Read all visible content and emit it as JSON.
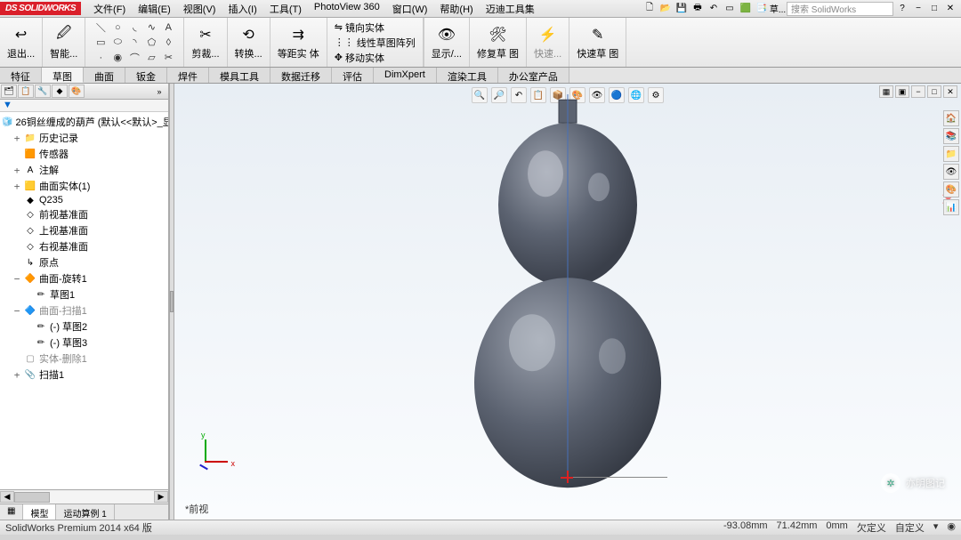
{
  "app": {
    "logo": "DS SOLIDWORKS"
  },
  "menu": [
    "文件(F)",
    "编辑(E)",
    "视图(V)",
    "插入(I)",
    "工具(T)",
    "PhotoView 360",
    "窗口(W)",
    "帮助(H)",
    "迈迪工具集"
  ],
  "search": {
    "placeholder": "搜索 SolidWorks"
  },
  "ribbon": {
    "exit": "退出...",
    "smart": "智能...",
    "trim": "剪裁...",
    "convert": "转换...",
    "offset": "等距实 体",
    "mirror": "镜向实体",
    "linear_pattern": "线性草图阵列",
    "move": "移动实体",
    "display": "显示/...",
    "repair": "修复草 图",
    "quick": "快速...",
    "quick_sketch": "快速草 图"
  },
  "tabs": [
    "特征",
    "草图",
    "曲面",
    "钣金",
    "焊件",
    "模具工具",
    "数据迁移",
    "评估",
    "DimXpert",
    "渲染工具",
    "办公室产品"
  ],
  "active_tab_index": 1,
  "tree": {
    "root": "26铜丝缠成的葫芦  (默认<<默认>_显示",
    "items": [
      {
        "icon": "📁",
        "label": "历史记录",
        "ind": 1,
        "tw": "+"
      },
      {
        "icon": "🟧",
        "label": "传感器",
        "ind": 1,
        "tw": ""
      },
      {
        "icon": "A",
        "label": "注解",
        "ind": 1,
        "tw": "+"
      },
      {
        "icon": "🟨",
        "label": "曲面实体(1)",
        "ind": 1,
        "tw": "+"
      },
      {
        "icon": "◆",
        "label": "Q235",
        "ind": 1,
        "tw": ""
      },
      {
        "icon": "◇",
        "label": "前视基准面",
        "ind": 1,
        "tw": ""
      },
      {
        "icon": "◇",
        "label": "上视基准面",
        "ind": 1,
        "tw": ""
      },
      {
        "icon": "◇",
        "label": "右视基准面",
        "ind": 1,
        "tw": ""
      },
      {
        "icon": "↳",
        "label": "原点",
        "ind": 1,
        "tw": ""
      },
      {
        "icon": "🔶",
        "label": "曲面-旋转1",
        "ind": 1,
        "tw": "−"
      },
      {
        "icon": "✏",
        "label": "草图1",
        "ind": 2,
        "tw": ""
      },
      {
        "icon": "🔷",
        "label": "曲面-扫描1",
        "ind": 1,
        "tw": "−",
        "dim": true
      },
      {
        "icon": "✏",
        "label": "(-) 草图2",
        "ind": 2,
        "tw": ""
      },
      {
        "icon": "✏",
        "label": "(-) 草图3",
        "ind": 2,
        "tw": ""
      },
      {
        "icon": "▢",
        "label": "实体-删除1",
        "ind": 1,
        "tw": "",
        "dim": true
      },
      {
        "icon": "📎",
        "label": "扫描1",
        "ind": 1,
        "tw": "+"
      }
    ]
  },
  "bottom_tabs": [
    "模型",
    "运动算例 1"
  ],
  "view_label": "*前视",
  "triad": {
    "x": "x",
    "y": "y"
  },
  "status": {
    "left": "SolidWorks Premium 2014 x64 版",
    "coords": [
      "-93.08mm",
      "71.42mm",
      "0mm"
    ],
    "def": "欠定义",
    "custom": "自定义"
  },
  "watermark": "亦明图记"
}
